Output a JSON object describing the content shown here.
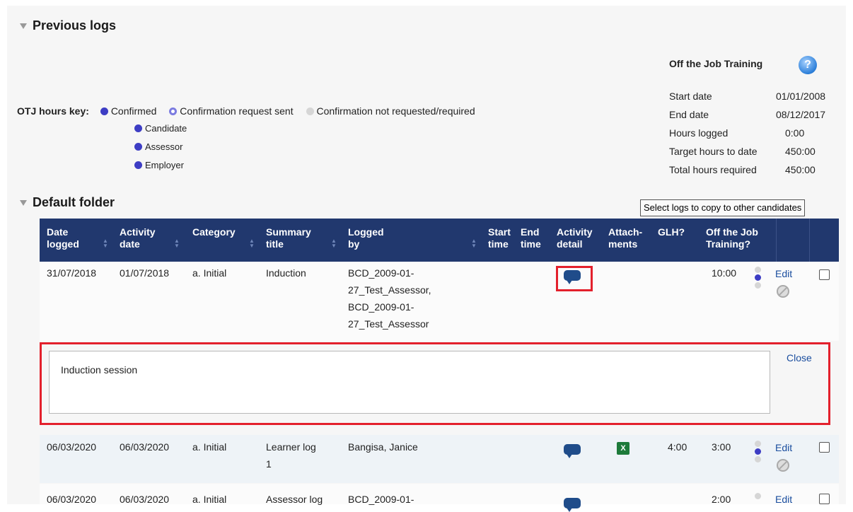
{
  "previous_logs": {
    "title": "Previous logs"
  },
  "otj_key": {
    "label": "OTJ hours key:",
    "items": [
      "Confirmed",
      "Confirmation request sent",
      "Confirmation not requested/required"
    ],
    "sub_items": [
      "Candidate",
      "Assessor",
      "Employer"
    ]
  },
  "otj_info": {
    "title": "Off the Job Training",
    "help_icon": "?",
    "rows": [
      {
        "label": "Start date",
        "value": "01/01/2008"
      },
      {
        "label": "End date",
        "value": "08/12/2017"
      },
      {
        "label": "Hours logged",
        "value": "0:00"
      },
      {
        "label": "Target hours to date",
        "value": "450:00"
      },
      {
        "label": "Total hours required",
        "value": "450:00"
      }
    ]
  },
  "folder": {
    "title": "Default folder",
    "copy_button": "Select logs to copy to other candidates"
  },
  "columns": {
    "date_logged": [
      "Date",
      "logged"
    ],
    "activity_date": [
      "Activity",
      "date"
    ],
    "category": [
      "Category"
    ],
    "summary_title": [
      "Summary",
      "title"
    ],
    "logged_by": [
      "Logged",
      "by"
    ],
    "start_time": [
      "Start",
      "time"
    ],
    "end_time": [
      "End",
      "time"
    ],
    "activity_detail": [
      "Activity",
      "detail"
    ],
    "attachments": [
      "Attach-",
      "ments"
    ],
    "glh": [
      "GLH?"
    ],
    "otj": [
      "Off the Job",
      "Training?"
    ]
  },
  "rows": [
    {
      "date_logged": "31/07/2018",
      "activity_date": "01/07/2018",
      "category": "a. Initial",
      "summary": [
        "Induction"
      ],
      "logged_by": [
        "BCD_2009-01-",
        "27_Test_Assessor,",
        "BCD_2009-01-",
        "27_Test_Assessor"
      ],
      "glh": "",
      "otj": "10:00",
      "edit": "Edit"
    },
    {
      "date_logged": "06/03/2020",
      "activity_date": "06/03/2020",
      "category": "a. Initial",
      "summary": [
        "Learner log",
        "1"
      ],
      "logged_by": [
        "Bangisa, Janice"
      ],
      "glh": "4:00",
      "otj": "3:00",
      "edit": "Edit"
    },
    {
      "date_logged": "06/03/2020",
      "activity_date": "06/03/2020",
      "category": "a. Initial",
      "summary": [
        "Assessor log"
      ],
      "logged_by": [
        "BCD_2009-01-"
      ],
      "glh": "",
      "otj": "2:00",
      "edit": "Edit"
    }
  ],
  "detail": {
    "text": "Induction session",
    "close": "Close"
  },
  "colors": {
    "header_bg": "#21386e",
    "confirmed": "#3d3dc4",
    "highlight": "#e3202c",
    "link": "#1a4d9e"
  }
}
